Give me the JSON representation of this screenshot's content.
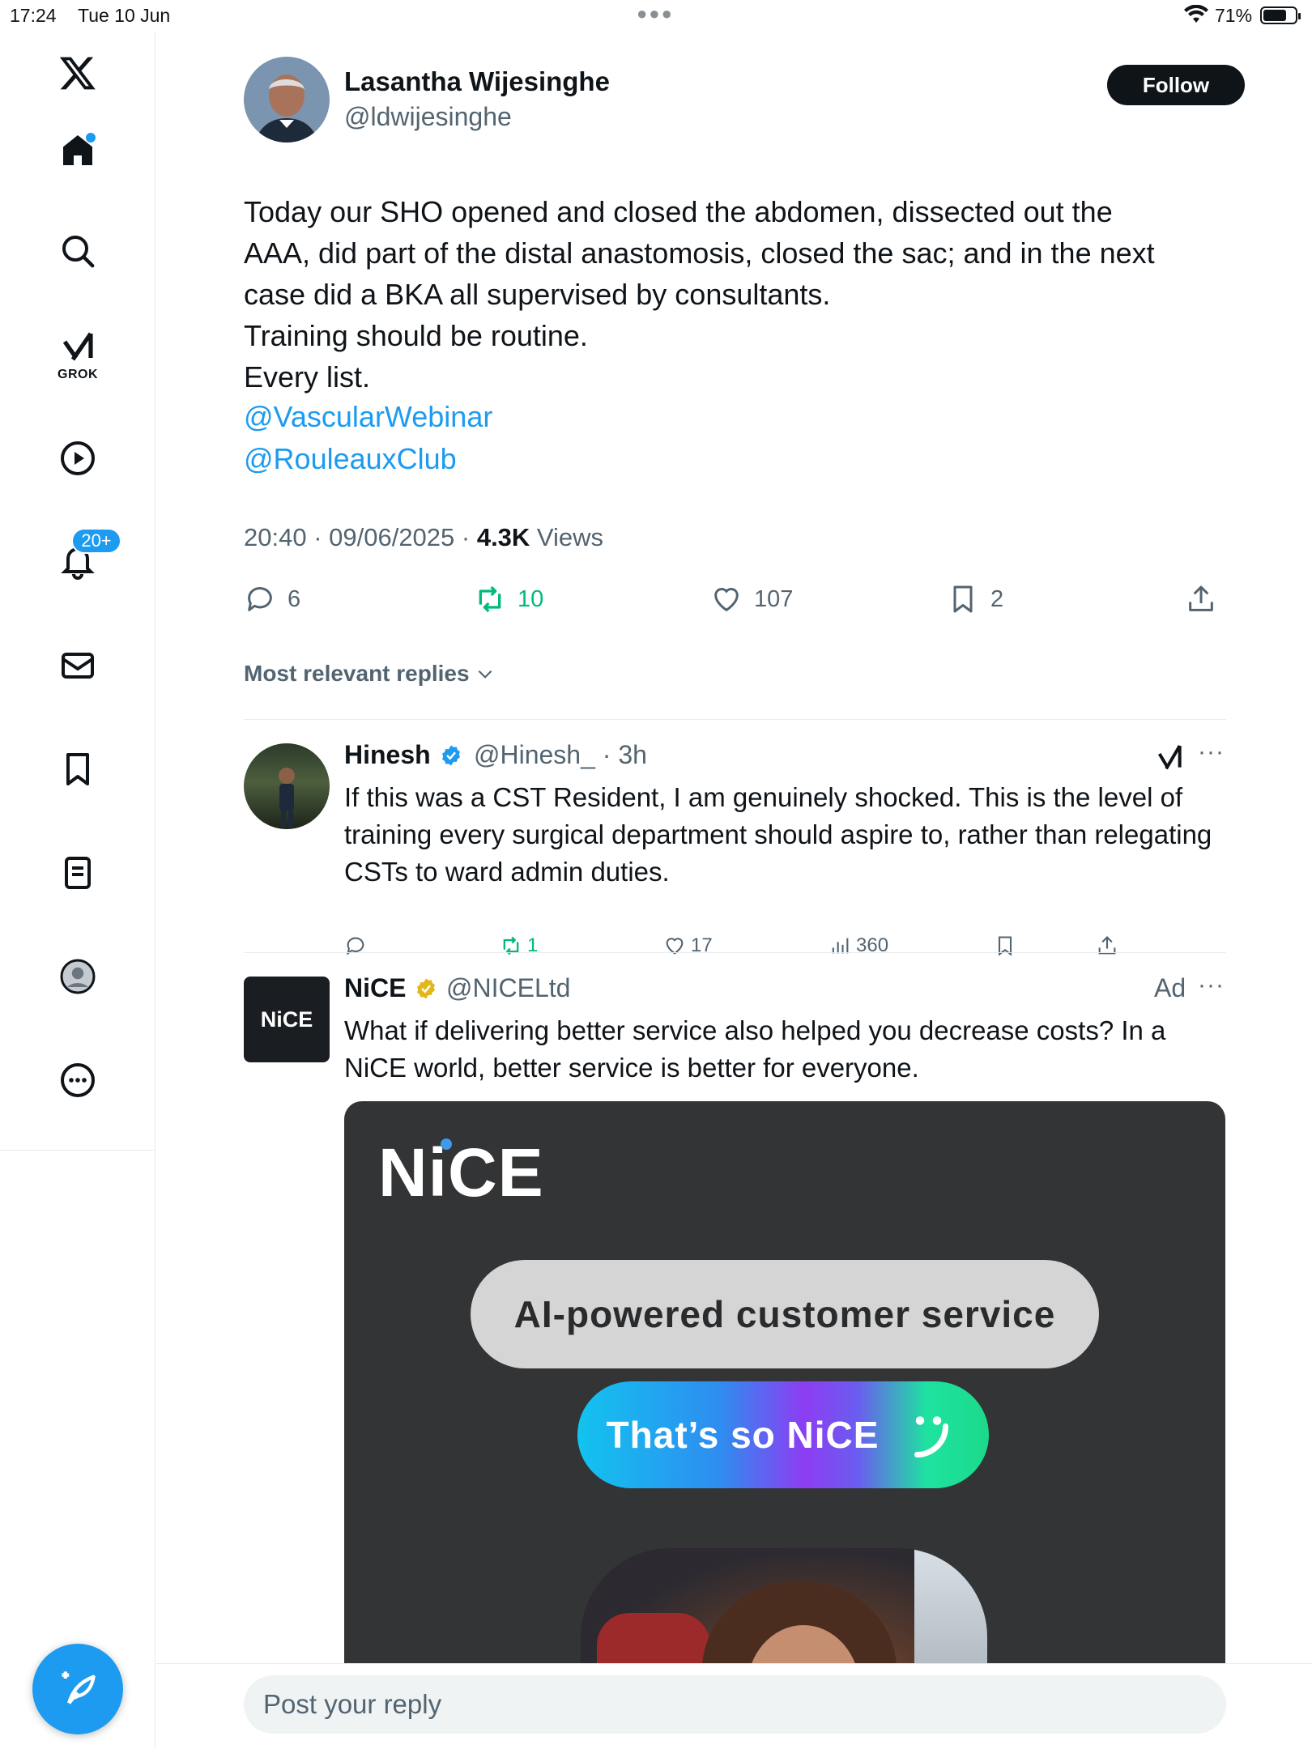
{
  "status_bar": {
    "time": "17:24",
    "date": "Tue 10 Jun",
    "battery": "71%"
  },
  "sidebar": {
    "grok_label": "GROK",
    "notifications_badge": "20+"
  },
  "post": {
    "author_name": "Lasantha Wijesinghe",
    "author_handle": "@ldwijesinghe",
    "follow_label": "Follow",
    "text": "Today our SHO opened and closed the abdomen, dissected out the\nAAA, did part of the distal anastomosis, closed the sac; and in the next\ncase did a BKA all supervised by consultants.\nTraining should be routine.\nEvery list.",
    "mentions": [
      "@VascularWebinar",
      "@RouleauxClub"
    ],
    "timestamp": "20:40 · 09/06/2025 · ",
    "views_count": "4.3K",
    "views_label": " Views",
    "replies": "6",
    "reposts": "10",
    "likes": "107",
    "bookmarks": "2"
  },
  "replies_section": {
    "sort_label": "Most relevant replies"
  },
  "replies": [
    {
      "name": "Hinesh",
      "handle": "@Hinesh_ · 3h",
      "text": "If this was a CST Resident, I am genuinely shocked. This is the level of training every surgical department should aspire to, rather than relegating CSTs to ward admin duties.",
      "reposts": "1",
      "likes": "17",
      "views": "360"
    }
  ],
  "ad": {
    "logo_text": "NiCE",
    "name": "NiCE",
    "handle": "@NICELtd",
    "ad_label": "Ad",
    "text": "What if delivering better service also helped you decrease costs? In a NiCE world, better service is better for everyone.",
    "media": {
      "brand": "NiCE",
      "pill_1": "AI-powered customer service",
      "pill_2": "That’s so NiCE"
    }
  },
  "reply_bar": {
    "placeholder": "Post your reply"
  },
  "colors": {
    "accent": "#1d9bf0",
    "repost_active": "#00ba7c",
    "text_secondary": "#536471",
    "verified_gold": "#e2b719"
  }
}
